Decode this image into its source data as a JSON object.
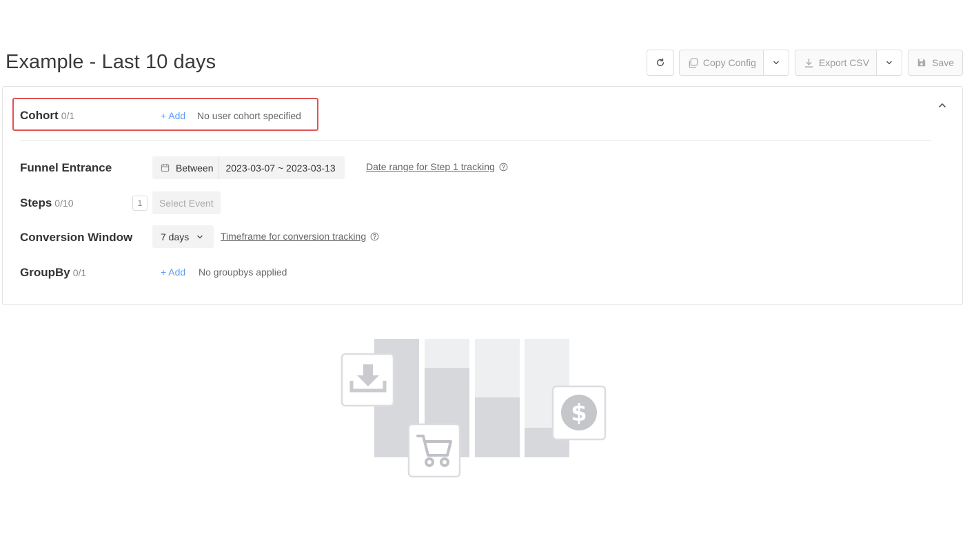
{
  "page": {
    "title": "Example - Last 10 days"
  },
  "toolbar": {
    "refresh_icon": "refresh-icon",
    "copy_config_label": "Copy Config",
    "export_csv_label": "Export CSV",
    "save_label": "Save"
  },
  "cohort": {
    "label": "Cohort",
    "count": "0/1",
    "add_label": "+ Add",
    "empty_text": "No user cohort specified"
  },
  "funnel_entrance": {
    "label": "Funnel Entrance",
    "mode": "Between",
    "range": "2023-03-07 ~ 2023-03-13",
    "help_text": "Date range for Step 1 tracking"
  },
  "steps": {
    "label": "Steps",
    "count": "0/10",
    "step_number": "1",
    "select_placeholder": "Select Event"
  },
  "conversion_window": {
    "label": "Conversion Window",
    "value": "7 days",
    "help_text": "Timeframe for conversion tracking"
  },
  "groupby": {
    "label": "GroupBy",
    "count": "0/1",
    "add_label": "+ Add",
    "empty_text": "No groupbys applied"
  },
  "colors": {
    "highlight_border": "#e05252",
    "link": "#5b9bf0",
    "illustration_fill": "#d6d8dc"
  }
}
